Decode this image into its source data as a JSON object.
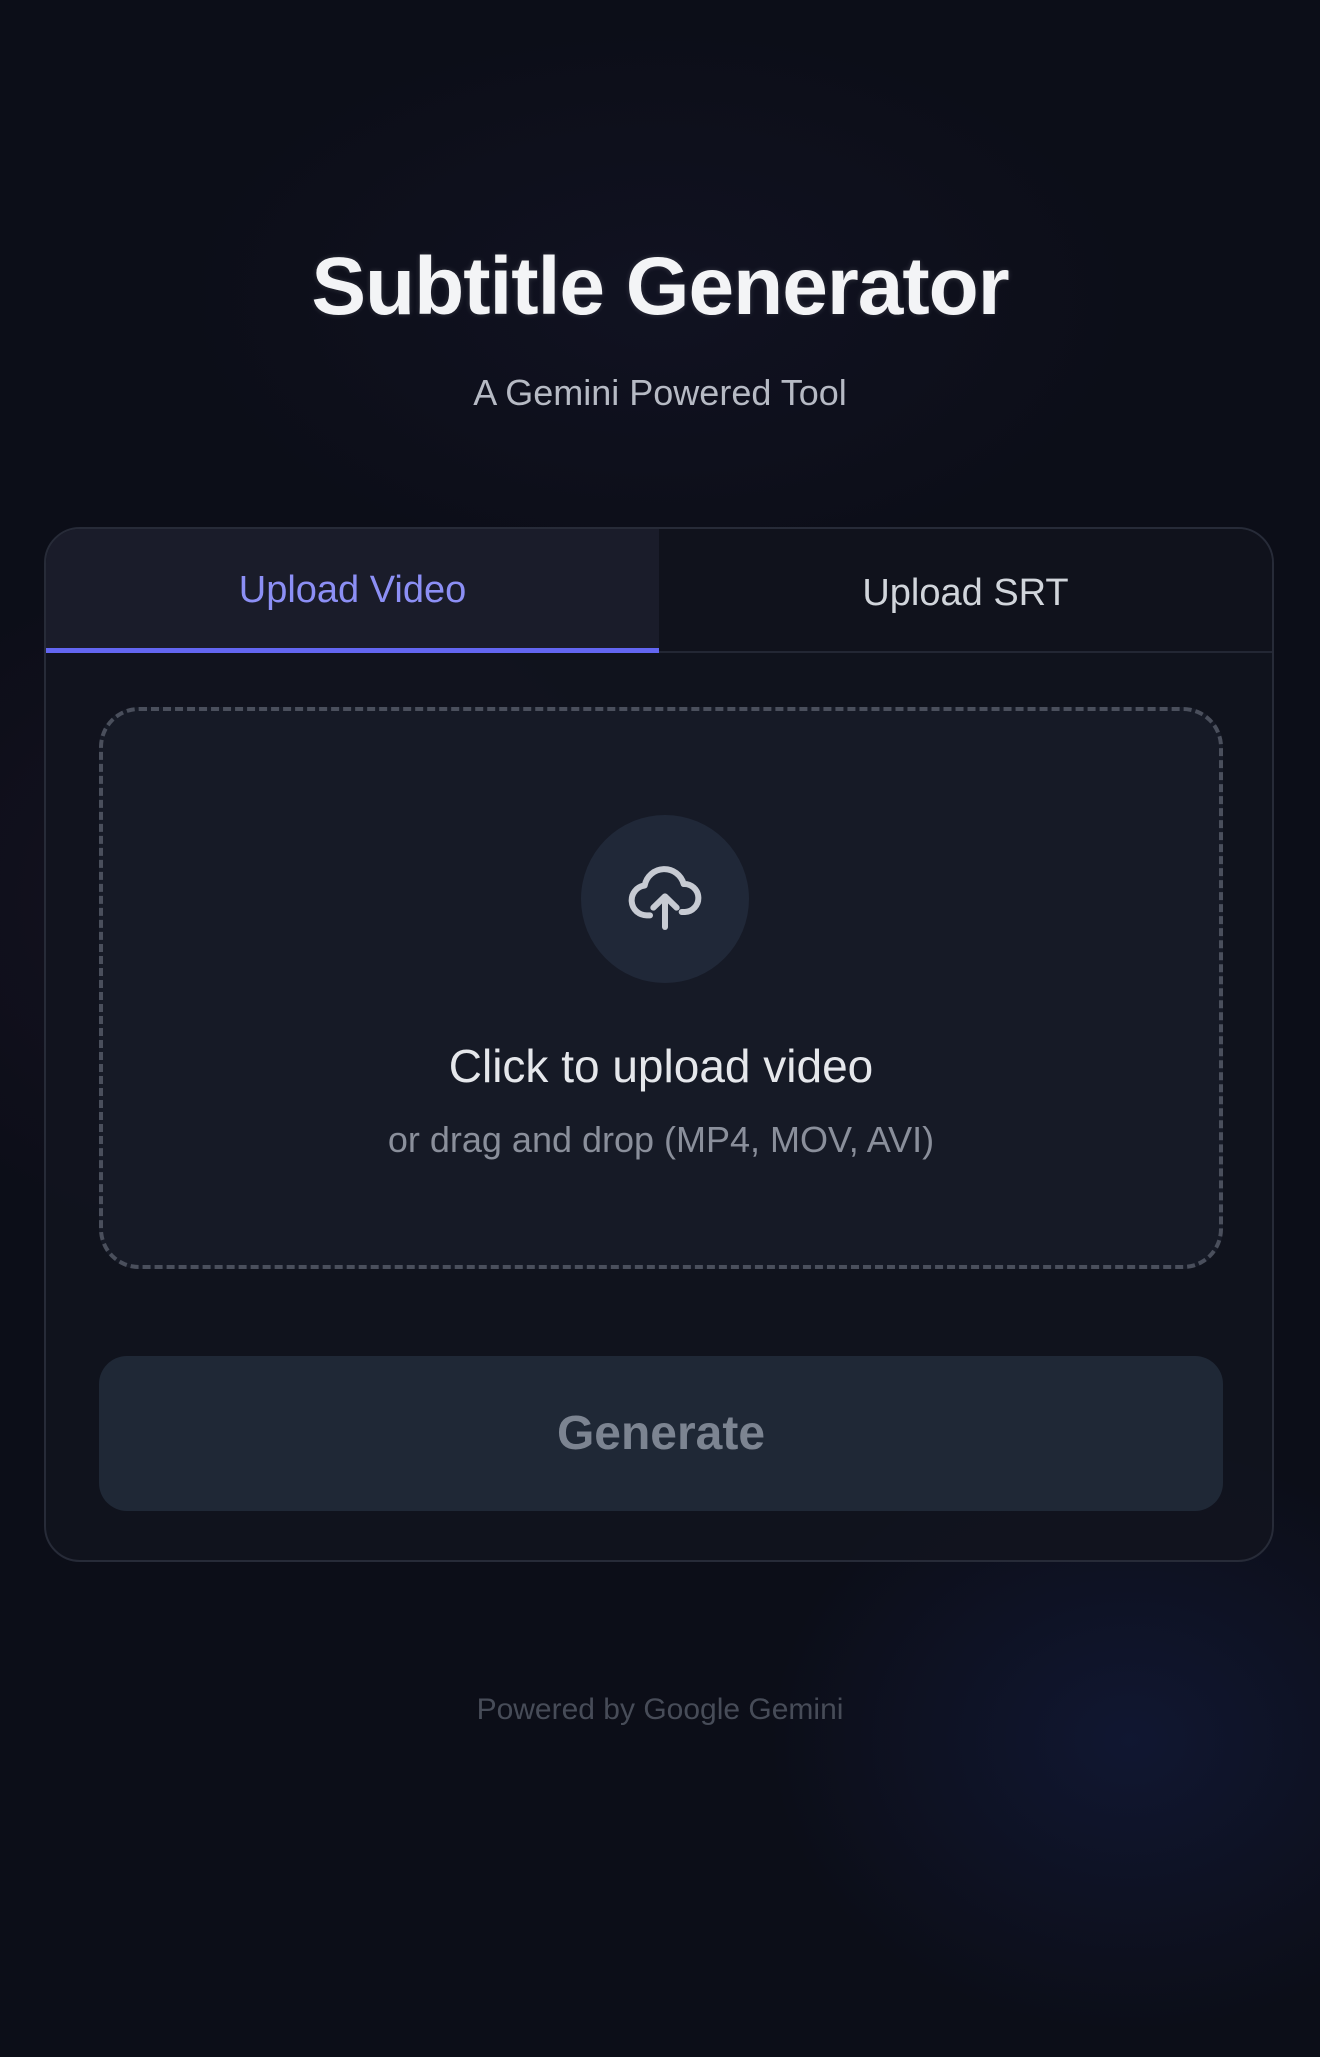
{
  "header": {
    "title": "Subtitle Generator",
    "subtitle": "A Gemini Powered Tool"
  },
  "tabs": [
    {
      "label": "Upload Video",
      "active": true
    },
    {
      "label": "Upload SRT",
      "active": false
    }
  ],
  "dropzone": {
    "icon": "cloud-upload-icon",
    "title": "Click to upload video",
    "hint": "or drag and drop (MP4, MOV, AVI)"
  },
  "actions": {
    "generate_label": "Generate"
  },
  "footer": {
    "text": "Powered by Google Gemini"
  },
  "colors": {
    "accent": "#6366f1",
    "accent_text": "#8c8ff5",
    "background": "#0c0e18",
    "card": "#11131e",
    "button": "#1f2836"
  }
}
